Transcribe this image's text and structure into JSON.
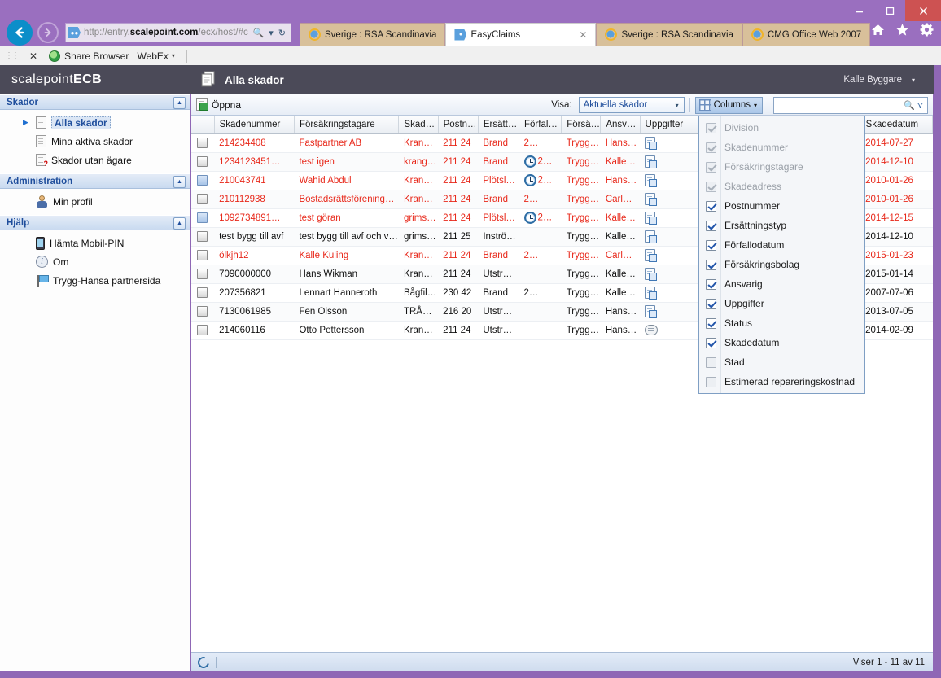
{
  "browser": {
    "address": {
      "protocol": "http://entry.",
      "domain": "scalepoint.com",
      "path": "/ecx/host/#c"
    },
    "window_controls": {
      "minimize": "minimize-icon",
      "maximize": "maximize-icon",
      "close": "close-icon"
    },
    "tabs": [
      {
        "label": "Sverige : RSA Scandinavia",
        "icon": "ie-icon",
        "active": false,
        "closable": false
      },
      {
        "label": "EasyClaims",
        "icon": "scalepoint-icon",
        "active": true,
        "closable": true,
        "close_label": "✕"
      },
      {
        "label": "Sverige : RSA Scandinavia",
        "icon": "ie-icon",
        "active": false,
        "closable": false
      },
      {
        "label": "CMG Office Web 2007",
        "icon": "ie-icon",
        "active": false,
        "closable": false
      }
    ],
    "right_icons": [
      "home-icon",
      "favorites-star-icon",
      "settings-gear-icon"
    ],
    "command_bar": {
      "close_label": "✕",
      "share_browser": "Share Browser",
      "webex": "WebEx",
      "webex_caret": "▾"
    }
  },
  "app": {
    "logo_light": "scalepoint",
    "logo_bold": "ECB",
    "page_title": "Alla skador",
    "page_title_icon": "documents-icon",
    "user_name": "Kalle Byggare",
    "user_caret": "▾"
  },
  "sidebar": {
    "sections": [
      {
        "title": "Skador",
        "collapse_icon": "▲",
        "items": [
          {
            "label": "Alla skador",
            "icon": "documents-stack-icon",
            "selected": true,
            "arrow": "▶"
          },
          {
            "label": "Mina aktiva skador",
            "icon": "document-icon",
            "selected": false
          },
          {
            "label": "Skador utan ägare",
            "icon": "document-question-icon",
            "selected": false
          }
        ]
      },
      {
        "title": "Administration",
        "collapse_icon": "▲",
        "items": [
          {
            "label": "Min profil",
            "icon": "person-icon",
            "selected": false
          }
        ]
      },
      {
        "title": "Hjälp",
        "collapse_icon": "▲",
        "items": [
          {
            "label": "Hämta Mobil-PIN",
            "icon": "mobile-phone-icon",
            "selected": false
          },
          {
            "label": "Om",
            "icon": "info-icon",
            "selected": false
          },
          {
            "label": "Trygg-Hansa partnersida",
            "icon": "flag-icon",
            "selected": false
          }
        ]
      }
    ]
  },
  "toolbar": {
    "open_label": "Öppna",
    "open_icon": "open-document-icon",
    "visa_label": "Visa:",
    "visa_value": "Aktuella skador",
    "visa_caret": "▾",
    "columns_label": "Columns",
    "columns_icon": "grid-columns-icon",
    "columns_caret": "▾",
    "search_value": "",
    "search_placeholder": "",
    "search_icon": "magnifier-icon",
    "search_more_icon": "double-chevron-down-icon"
  },
  "columns_menu": {
    "items": [
      {
        "label": "Division",
        "checked": true,
        "disabled": true
      },
      {
        "label": "Skadenummer",
        "checked": true,
        "disabled": true
      },
      {
        "label": "Försäkringstagare",
        "checked": true,
        "disabled": true
      },
      {
        "label": "Skadeadress",
        "checked": true,
        "disabled": true
      },
      {
        "label": "Postnummer",
        "checked": true,
        "disabled": false
      },
      {
        "label": "Ersättningstyp",
        "checked": true,
        "disabled": false
      },
      {
        "label": "Förfallodatum",
        "checked": true,
        "disabled": false
      },
      {
        "label": "Försäkringsbolag",
        "checked": true,
        "disabled": false
      },
      {
        "label": "Ansvarig",
        "checked": true,
        "disabled": false
      },
      {
        "label": "Uppgifter",
        "checked": true,
        "disabled": false
      },
      {
        "label": "Status",
        "checked": true,
        "disabled": false
      },
      {
        "label": "Skadedatum",
        "checked": true,
        "disabled": false
      },
      {
        "label": "Stad",
        "checked": false,
        "disabled": false
      },
      {
        "label": "Estimerad repareringskostnad",
        "checked": false,
        "disabled": false
      }
    ]
  },
  "grid": {
    "headers": [
      "",
      "Skadenummer",
      "Försäkringstagare",
      "Skad…",
      "Postn…",
      "Ersätt…",
      "Förfal…",
      "Försä…",
      "Ansv…",
      "Uppgifter",
      "",
      "Skadedatum"
    ],
    "rows": [
      {
        "checkbox_highlight": false,
        "overdue": true,
        "skadenummer": "214234408",
        "forsakringstagare": "Fastpartner AB",
        "skadeadress": "Kran…",
        "postnummer": "211 24",
        "ersattningstyp": "Brand",
        "clock": false,
        "forfallodatum": "2…",
        "forsakringsbolag": "Trygg…",
        "ansvarig": "Hans…",
        "uppgifter_icon": "task-icon",
        "skadedatum": "2014-07-27"
      },
      {
        "checkbox_highlight": false,
        "overdue": true,
        "skadenummer": "1234123451…",
        "forsakringstagare": "test igen",
        "skadeadress": "krang…",
        "postnummer": "211 24",
        "ersattningstyp": "Brand",
        "clock": true,
        "forfallodatum": "2…",
        "forsakringsbolag": "Trygg…",
        "ansvarig": "Kalle…",
        "uppgifter_icon": "task-icon",
        "skadedatum": "2014-12-10"
      },
      {
        "checkbox_highlight": true,
        "overdue": true,
        "skadenummer": "210043741",
        "forsakringstagare": "Wahid Abdul",
        "skadeadress": "Kran…",
        "postnummer": "211 24",
        "ersattningstyp": "Plötsl…",
        "clock": true,
        "forfallodatum": "2…",
        "forsakringsbolag": "Trygg…",
        "ansvarig": "Hans…",
        "uppgifter_icon": "task-icon",
        "skadedatum": "2010-01-26"
      },
      {
        "checkbox_highlight": false,
        "overdue": true,
        "skadenummer": "210112938",
        "forsakringstagare": "Bostadsrättsförening…",
        "skadeadress": "Kran…",
        "postnummer": "211 24",
        "ersattningstyp": "Brand",
        "clock": false,
        "forfallodatum": "2…",
        "forsakringsbolag": "Trygg…",
        "ansvarig": "Carl…",
        "uppgifter_icon": "task-icon",
        "skadedatum": "2010-01-26"
      },
      {
        "checkbox_highlight": true,
        "overdue": true,
        "skadenummer": "1092734891…",
        "forsakringstagare": "test göran",
        "skadeadress": "grims…",
        "postnummer": "211 24",
        "ersattningstyp": "Plötsl…",
        "clock": true,
        "forfallodatum": "2…",
        "forsakringsbolag": "Trygg…",
        "ansvarig": "Kalle…",
        "uppgifter_icon": "task-icon",
        "skadedatum": "2014-12-15"
      },
      {
        "checkbox_highlight": false,
        "overdue": false,
        "skadenummer": "test bygg till avf",
        "forsakringstagare": "test bygg till avf och v…",
        "skadeadress": "grims…",
        "postnummer": "211 25",
        "ersattningstyp": "Inströ…",
        "clock": false,
        "forfallodatum": "",
        "forsakringsbolag": "Trygg…",
        "ansvarig": "Kalle…",
        "uppgifter_icon": "task-icon",
        "skadedatum": "2014-12-10"
      },
      {
        "checkbox_highlight": false,
        "overdue": true,
        "skadenummer": "ölkjh12",
        "forsakringstagare": "Kalle Kuling",
        "skadeadress": "Kran…",
        "postnummer": "211 24",
        "ersattningstyp": "Brand",
        "clock": false,
        "forfallodatum": "2…",
        "forsakringsbolag": "Trygg…",
        "ansvarig": "Carl…",
        "uppgifter_icon": "task-icon",
        "skadedatum": "2015-01-23"
      },
      {
        "checkbox_highlight": false,
        "overdue": false,
        "skadenummer": "7090000000",
        "forsakringstagare": "Hans Wikman",
        "skadeadress": "Kran…",
        "postnummer": "211 24",
        "ersattningstyp": "Utstr…",
        "clock": false,
        "forfallodatum": "",
        "forsakringsbolag": "Trygg…",
        "ansvarig": "Kalle…",
        "uppgifter_icon": "task-icon",
        "skadedatum": "2015-01-14"
      },
      {
        "checkbox_highlight": false,
        "overdue": false,
        "skadenummer": "207356821",
        "forsakringstagare": "Lennart Hanneroth",
        "skadeadress": "Bågfil…",
        "postnummer": "230 42",
        "ersattningstyp": "Brand",
        "clock": false,
        "forfallodatum": "2…",
        "forsakringsbolag": "Trygg…",
        "ansvarig": "Kalle…",
        "uppgifter_icon": "task-icon",
        "skadedatum": "2007-07-06"
      },
      {
        "checkbox_highlight": false,
        "overdue": false,
        "skadenummer": "7130061985",
        "forsakringstagare": "Fen Olsson",
        "skadeadress": "TRÅ…",
        "postnummer": "216 20",
        "ersattningstyp": "Utstr…",
        "clock": false,
        "forfallodatum": "",
        "forsakringsbolag": "Trygg…",
        "ansvarig": "Hans…",
        "uppgifter_icon": "task-icon",
        "skadedatum": "2013-07-05"
      },
      {
        "checkbox_highlight": false,
        "overdue": false,
        "skadenummer": "214060116",
        "forsakringstagare": "Otto Pettersson",
        "skadeadress": "Kran…",
        "postnummer": "211 24",
        "ersattningstyp": "Utstr…",
        "clock": false,
        "forfallodatum": "",
        "forsakringsbolag": "Trygg…",
        "ansvarig": "Hans…",
        "uppgifter_icon": "note-icon",
        "skadedatum": "2014-02-09"
      }
    ]
  },
  "statusbar": {
    "refresh_icon": "refresh-icon",
    "count_text": "Viser 1 - 11 av 11"
  }
}
